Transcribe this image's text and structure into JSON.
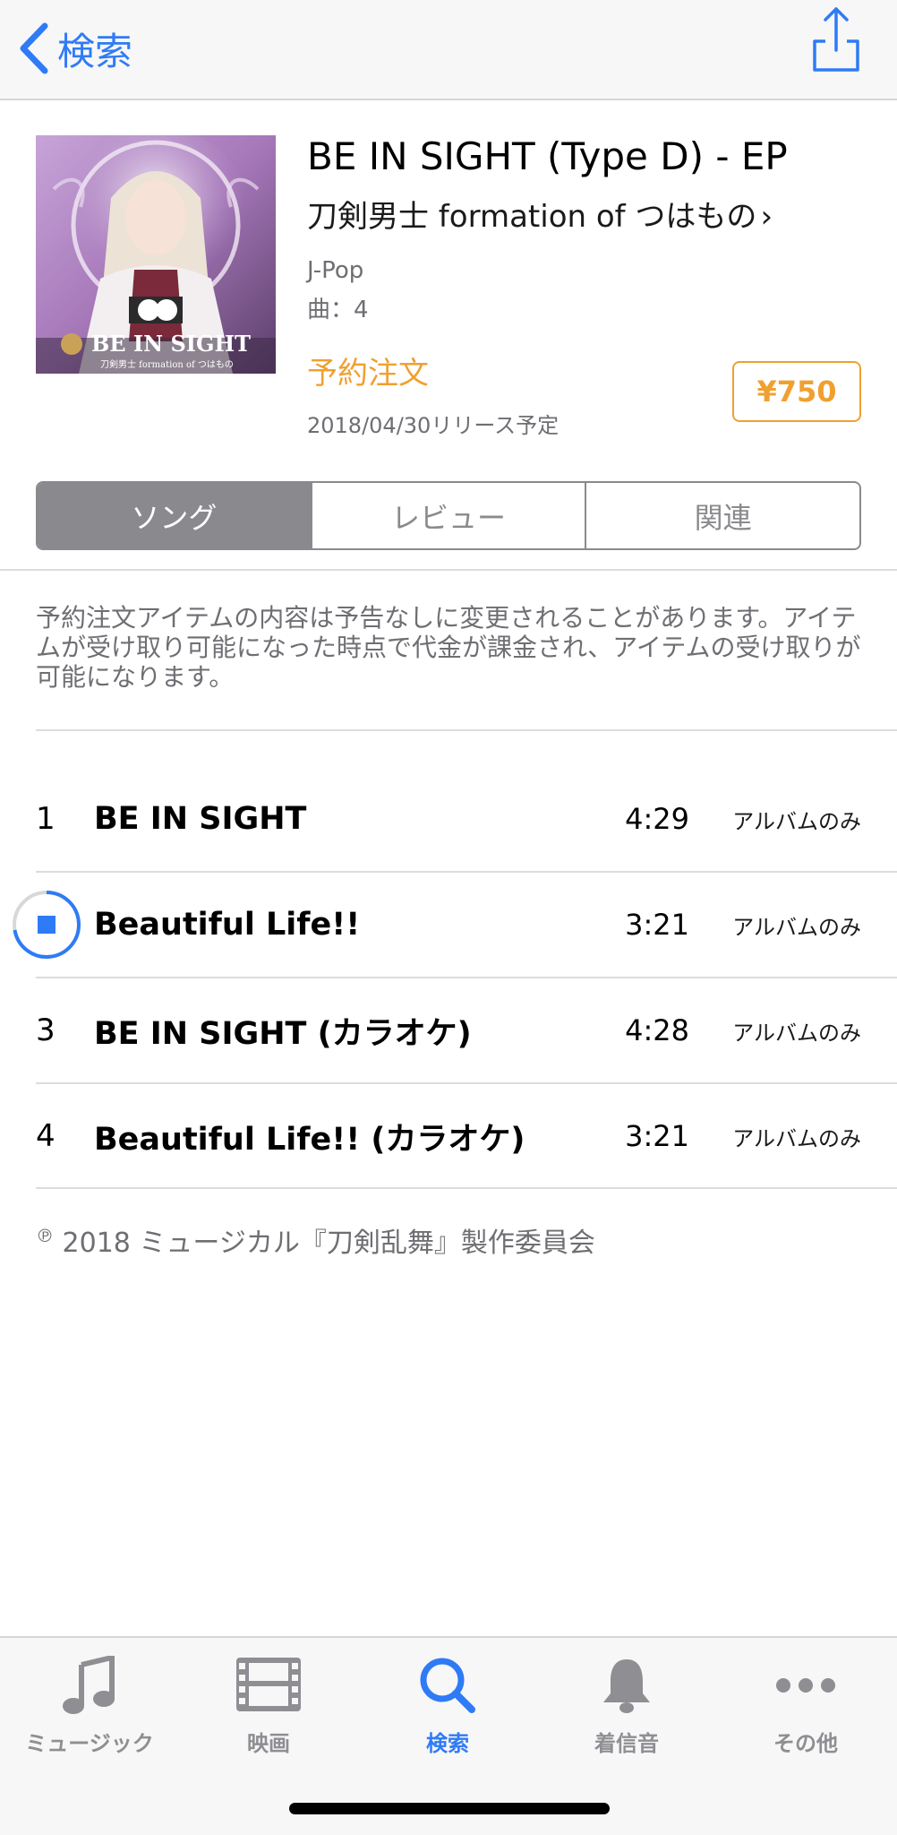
{
  "nav": {
    "back_label": "検索"
  },
  "album": {
    "title": "BE IN SIGHT (Type D) - EP",
    "artist": "刀剣男士 formation of つはもの",
    "artist_chevron": "›",
    "genre": "J-Pop",
    "track_count": "曲：4",
    "preorder_label": "予約注文",
    "release_date": "2018/04/30リリース予定",
    "price": "¥750",
    "artwork_text": {
      "main": "BE IN SIGHT",
      "sub": "刀剣男士 formation of つはもの"
    }
  },
  "segments": [
    {
      "label": "ソング",
      "active": true
    },
    {
      "label": "レビュー",
      "active": false
    },
    {
      "label": "関連",
      "active": false
    }
  ],
  "notice": "予約注文アイテムの内容は予告なしに変更されることがあります。アイテムが受け取り可能になった時点で代金が課金され、アイテムの受け取りが可能になります。",
  "tracks": [
    {
      "number": "1",
      "title": "BE IN SIGHT",
      "duration": "4:29",
      "availability": "アルバムのみ",
      "playing": false
    },
    {
      "number": "2",
      "title": "Beautiful Life!!",
      "duration": "3:21",
      "availability": "アルバムのみ",
      "playing": true
    },
    {
      "number": "3",
      "title": "BE IN SIGHT (カラオケ)",
      "duration": "4:28",
      "availability": "アルバムのみ",
      "playing": false
    },
    {
      "number": "4",
      "title": "Beautiful Life!! (カラオケ)",
      "duration": "3:21",
      "availability": "アルバムのみ",
      "playing": false
    }
  ],
  "copyright": {
    "mark": "℗",
    "text": "2018 ミュージカル『刀剣乱舞』製作委員会"
  },
  "tabbar": {
    "items": [
      {
        "label": "ミュージック",
        "icon": "music-note-icon",
        "active": false
      },
      {
        "label": "映画",
        "icon": "film-icon",
        "active": false
      },
      {
        "label": "検索",
        "icon": "search-icon",
        "active": true
      },
      {
        "label": "着信音",
        "icon": "bell-icon",
        "active": false
      },
      {
        "label": "その他",
        "icon": "more-icon",
        "active": false
      }
    ]
  },
  "colors": {
    "accent_blue": "#2f7bf6",
    "preorder_orange": "#f0a030",
    "segment_gray": "#8a8a8e",
    "secondary_text": "#6e6e73"
  }
}
